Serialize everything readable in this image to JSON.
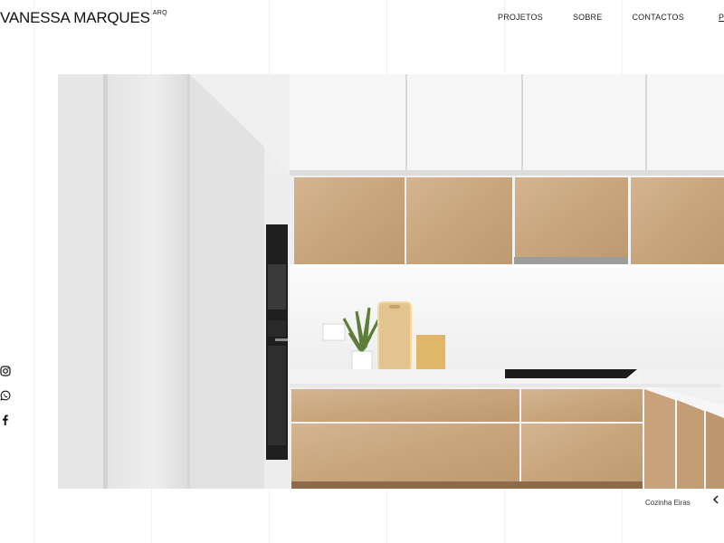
{
  "site": {
    "logo_name": "VANESSA MARQUES",
    "logo_sup": "ARQ"
  },
  "nav": {
    "items": [
      "PROJETOS",
      "SOBRE",
      "CONTACTOS"
    ],
    "lang": "P"
  },
  "social": {
    "icons": [
      "instagram-icon",
      "whatsapp-icon",
      "facebook-icon"
    ]
  },
  "hero": {
    "caption": "Cozinha Eiras",
    "prev_icon": "chevron-left-icon"
  },
  "colors": {
    "text": "#111111",
    "wood": "#c9a882",
    "cabinet_white": "#f5f5f5",
    "background": "#ffffff"
  }
}
